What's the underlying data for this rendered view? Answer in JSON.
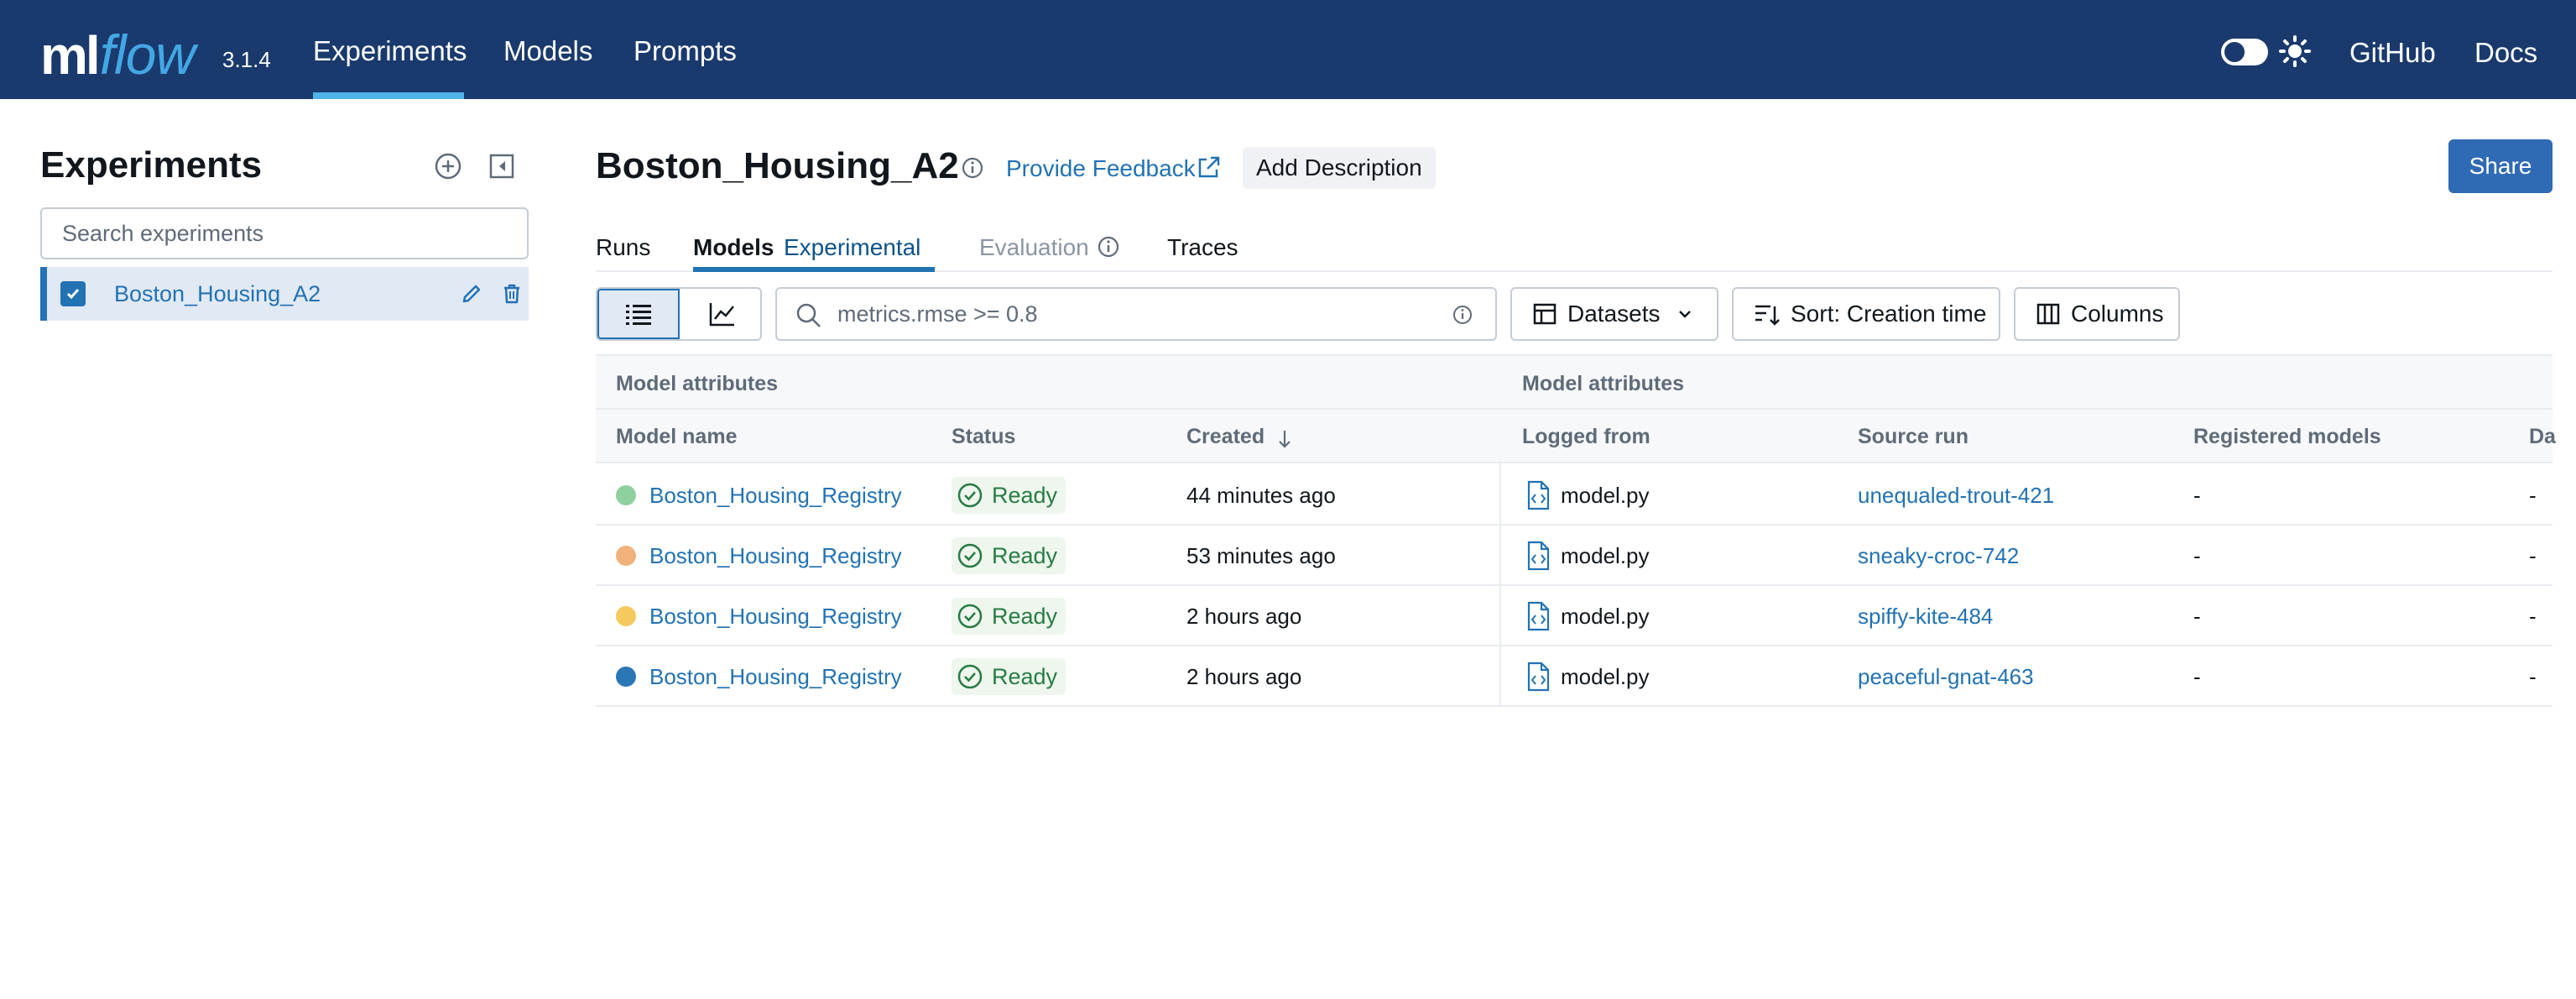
{
  "header": {
    "logo_ml": "ml",
    "logo_flow": "flow",
    "version": "3.1.4",
    "nav": [
      {
        "label": "Experiments",
        "active": true
      },
      {
        "label": "Models",
        "active": false
      },
      {
        "label": "Prompts",
        "active": false
      }
    ],
    "right_links": [
      "GitHub",
      "Docs"
    ]
  },
  "sidebar": {
    "title": "Experiments",
    "search_placeholder": "Search experiments",
    "experiments": [
      {
        "name": "Boston_Housing_A2",
        "checked": true
      }
    ]
  },
  "main": {
    "title": "Boston_Housing_A2",
    "feedback_label": "Provide Feedback",
    "add_description_label": "Add Description",
    "share_label": "Share",
    "tabs": [
      {
        "label": "Runs"
      },
      {
        "label": "Models",
        "badge": "Experimental",
        "active": true
      },
      {
        "label": "Evaluation",
        "disabled": true
      },
      {
        "label": "Traces"
      }
    ],
    "filter_placeholder": "metrics.rmse >= 0.8",
    "datasets_label": "Datasets",
    "sort_label": "Sort: Creation time",
    "columns_label": "Columns"
  },
  "table": {
    "group_headers": [
      "Model attributes",
      "Model attributes"
    ],
    "columns": [
      "Model name",
      "Status",
      "Created",
      "Logged from",
      "Source run",
      "Registered models",
      "Da"
    ],
    "rows": [
      {
        "color": "#8fd19e",
        "model_name": "Boston_Housing_Registry",
        "status": "Ready",
        "created": "44 minutes ago",
        "logged_from": "model.py",
        "source_run": "unequaled-trout-421",
        "registered": "-",
        "extra": "-"
      },
      {
        "color": "#f0b27a",
        "model_name": "Boston_Housing_Registry",
        "status": "Ready",
        "created": "53 minutes ago",
        "logged_from": "model.py",
        "source_run": "sneaky-croc-742",
        "registered": "-",
        "extra": "-"
      },
      {
        "color": "#f4c95d",
        "model_name": "Boston_Housing_Registry",
        "status": "Ready",
        "created": "2 hours ago",
        "logged_from": "model.py",
        "source_run": "spiffy-kite-484",
        "registered": "-",
        "extra": "-"
      },
      {
        "color": "#2d76b5",
        "model_name": "Boston_Housing_Registry",
        "status": "Ready",
        "created": "2 hours ago",
        "logged_from": "model.py",
        "source_run": "peaceful-gnat-463",
        "registered": "-",
        "extra": "-"
      }
    ]
  }
}
